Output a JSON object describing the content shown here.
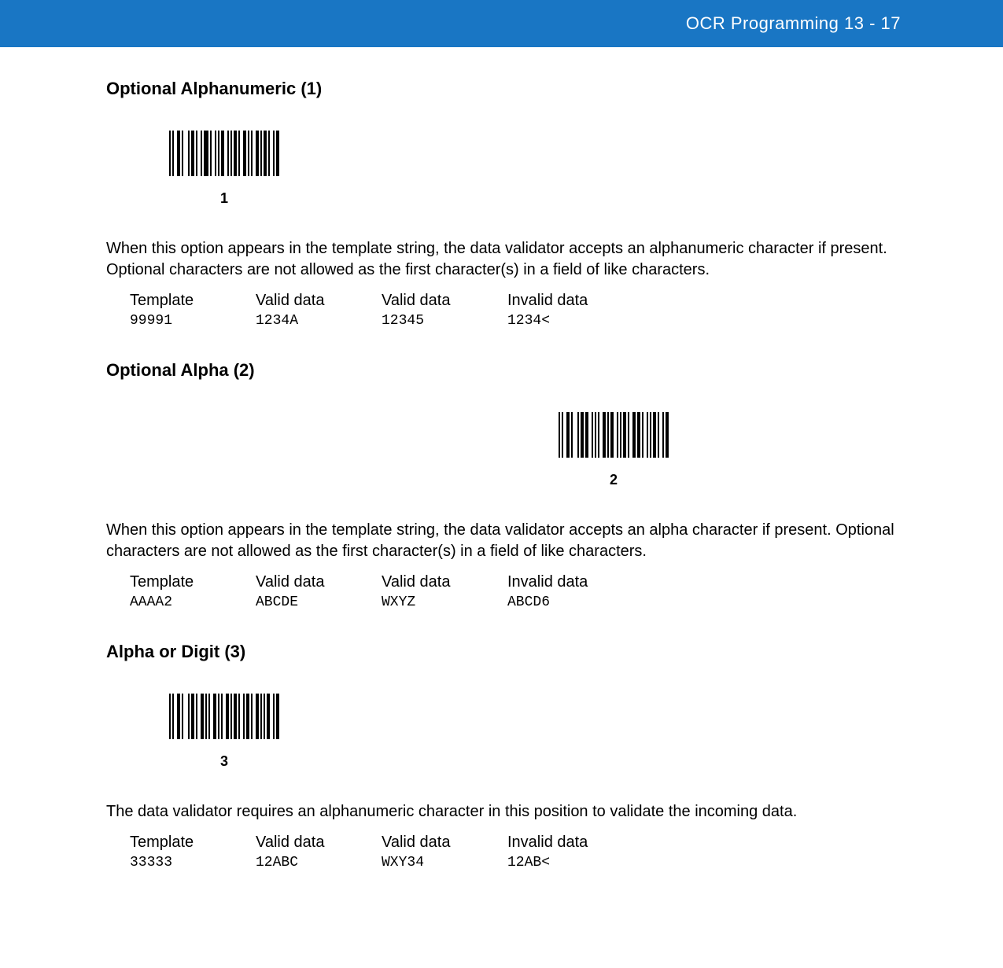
{
  "header": {
    "title": "OCR Programming  13 - 17"
  },
  "sections": [
    {
      "heading": "Optional Alphanumeric (1)",
      "barcode_label": "1",
      "barcode_position": "left",
      "body": "When this option appears in the template string, the data validator accepts an alphanumeric character if present. Optional characters are not allowed as the first character(s) in a field of like characters.",
      "table": {
        "headers": [
          "Template",
          "Valid data",
          "Valid data",
          "Invalid data"
        ],
        "row": [
          "99991",
          "1234A",
          "12345",
          "1234<"
        ]
      }
    },
    {
      "heading": "Optional Alpha (2)",
      "barcode_label": "2",
      "barcode_position": "right",
      "body": "When this option appears in the template string, the data validator accepts an alpha character if present. Optional characters are not allowed as the first character(s) in a field of like characters.",
      "table": {
        "headers": [
          "Template",
          "Valid data",
          "Valid data",
          "Invalid data"
        ],
        "row": [
          "AAAA2",
          "ABCDE",
          "WXYZ",
          "ABCD6"
        ]
      }
    },
    {
      "heading": "Alpha or Digit (3)",
      "barcode_label": "3",
      "barcode_position": "left",
      "body": "The data validator requires an alphanumeric character in this position to validate the incoming data.",
      "table": {
        "headers": [
          "Template",
          "Valid data",
          "Valid data",
          "Invalid data"
        ],
        "row": [
          "33333",
          "12ABC",
          "WXY34",
          "12AB<"
        ]
      }
    }
  ]
}
